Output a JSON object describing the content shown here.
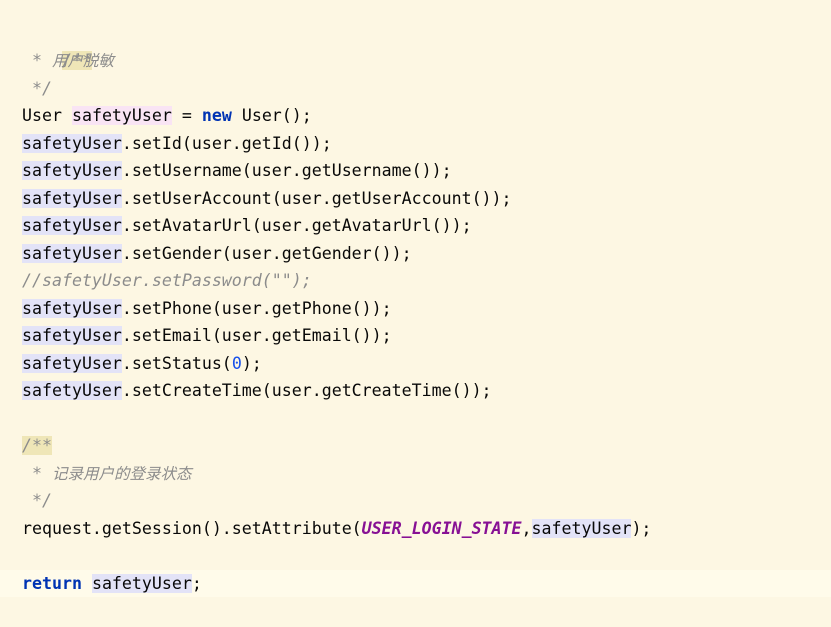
{
  "code": {
    "doc1_open": "/**",
    "doc1_star_prefix": " * ",
    "doc1_text": "用户脱敏",
    "doc1_close": " */",
    "class_user": "User",
    "var_name": "safetyUser",
    "assign_op": " = ",
    "kw_new": "new",
    "ctor_call": " User();",
    "set_id": ".setId(user.getId());",
    "set_username": ".setUsername(user.getUsername());",
    "set_user_account": ".setUserAccount(user.getUserAccount());",
    "set_avatar_url": ".setAvatarUrl(user.getAvatarUrl());",
    "set_gender": ".setGender(user.getGender());",
    "commented_password": "//safetyUser.setPassword(\"\");",
    "set_phone": ".setPhone(user.getPhone());",
    "set_email": ".setEmail(user.getEmail());",
    "set_status_pre": ".setStatus(",
    "set_status_num": "0",
    "set_status_post": ");",
    "set_create_time": ".setCreateTime(user.getCreateTime());",
    "doc2_open": "/**",
    "doc2_star_prefix": " * ",
    "doc2_text": "记录用户的登录状态",
    "doc2_close": " */",
    "session_call": "request.getSession().setAttribute(",
    "const_login_state": "USER_LOGIN_STATE",
    "comma": ",",
    "session_end": ");",
    "kw_return": "return",
    "space": " ",
    "semicolon": ";"
  },
  "colors": {
    "background": "#fdf7e3",
    "keyword": "#0033b3",
    "comment": "#8c8c8c",
    "constant": "#871094",
    "number": "#1750eb",
    "usage_highlight": "#e3e3f7",
    "write_highlight": "#f9e4f4"
  }
}
